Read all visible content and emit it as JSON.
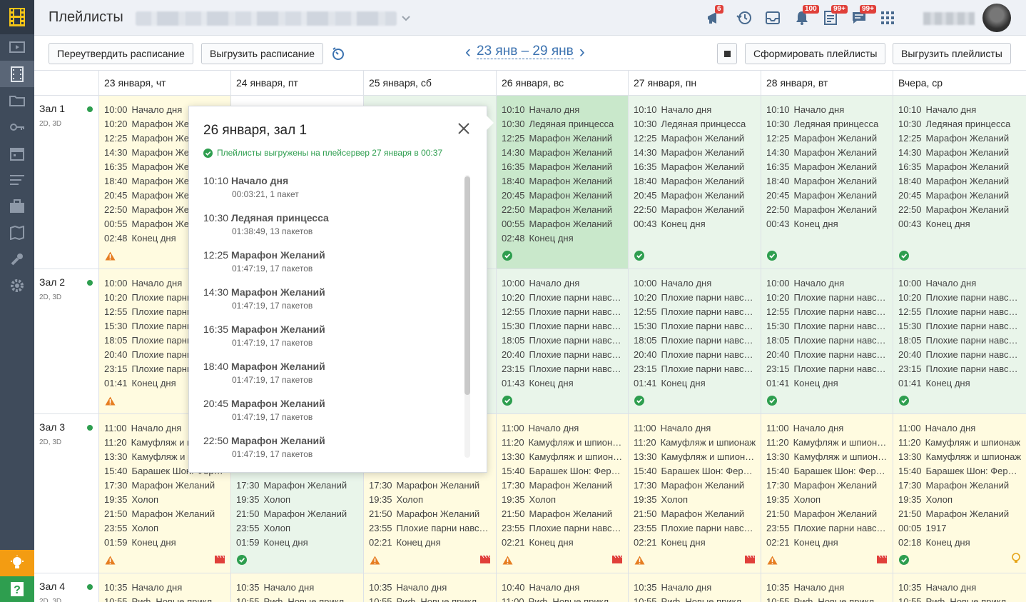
{
  "header": {
    "title": "Плейлисты",
    "badges": {
      "announcements": "6",
      "notifications": "100",
      "tasks": "99+",
      "messages": "99+"
    }
  },
  "toolbar": {
    "reapprove_label": "Переутвердить расписание",
    "export_schedule_label": "Выгрузить расписание",
    "week_label": "23 янв – 29 янв",
    "prev": "‹",
    "next": "›",
    "generate_label": "Сформировать плейлисты",
    "export_playlists_label": "Выгрузить плейлисты"
  },
  "days": [
    "23 января, чт",
    "24 января, пт",
    "25 января, сб",
    "26 января, вс",
    "27 января, пн",
    "28 января, вт",
    "Вчера, ср"
  ],
  "halls": [
    {
      "name": "Зал 1",
      "formats": "2D, 3D",
      "cells": [
        {
          "bg": "yellow",
          "status": "warning",
          "rows": [
            [
              "10:00",
              "Начало дня"
            ],
            [
              "10:20",
              "Марафон Желаний"
            ],
            [
              "12:25",
              "Марафон Желаний"
            ],
            [
              "14:30",
              "Марафон Желаний"
            ],
            [
              "16:35",
              "Марафон Желаний"
            ],
            [
              "18:40",
              "Марафон Желаний"
            ],
            [
              "20:45",
              "Марафон Желаний"
            ],
            [
              "22:50",
              "Марафон Желаний"
            ],
            [
              "00:55",
              "Марафон Желаний"
            ],
            [
              "02:48",
              "Конец дня"
            ]
          ]
        },
        {
          "bg": "none",
          "status": "none",
          "rows": []
        },
        {
          "bg": "green",
          "status": "none",
          "rows": []
        },
        {
          "bg": "green-strong",
          "status": "ok",
          "rows": [
            [
              "10:10",
              "Начало дня"
            ],
            [
              "10:30",
              "Ледяная принцесса"
            ],
            [
              "12:25",
              "Марафон Желаний"
            ],
            [
              "14:30",
              "Марафон Желаний"
            ],
            [
              "16:35",
              "Марафон Желаний"
            ],
            [
              "18:40",
              "Марафон Желаний"
            ],
            [
              "20:45",
              "Марафон Желаний"
            ],
            [
              "22:50",
              "Марафон Желаний"
            ],
            [
              "00:55",
              "Марафон Желаний"
            ],
            [
              "02:48",
              "Конец дня"
            ]
          ]
        },
        {
          "bg": "green",
          "status": "ok",
          "rows": [
            [
              "10:10",
              "Начало дня"
            ],
            [
              "10:30",
              "Ледяная принцесса"
            ],
            [
              "12:25",
              "Марафон Желаний"
            ],
            [
              "14:30",
              "Марафон Желаний"
            ],
            [
              "16:35",
              "Марафон Желаний"
            ],
            [
              "18:40",
              "Марафон Желаний"
            ],
            [
              "20:45",
              "Марафон Желаний"
            ],
            [
              "22:50",
              "Марафон Желаний"
            ],
            [
              "00:43",
              "Конец дня"
            ]
          ]
        },
        {
          "bg": "green",
          "status": "ok",
          "rows": [
            [
              "10:10",
              "Начало дня"
            ],
            [
              "10:30",
              "Ледяная принцесса"
            ],
            [
              "12:25",
              "Марафон Желаний"
            ],
            [
              "14:30",
              "Марафон Желаний"
            ],
            [
              "16:35",
              "Марафон Желаний"
            ],
            [
              "18:40",
              "Марафон Желаний"
            ],
            [
              "20:45",
              "Марафон Желаний"
            ],
            [
              "22:50",
              "Марафон Желаний"
            ],
            [
              "00:43",
              "Конец дня"
            ]
          ]
        },
        {
          "bg": "green",
          "status": "ok",
          "rows": [
            [
              "10:10",
              "Начало дня"
            ],
            [
              "10:30",
              "Ледяная принцесса"
            ],
            [
              "12:25",
              "Марафон Желаний"
            ],
            [
              "14:30",
              "Марафон Желаний"
            ],
            [
              "16:35",
              "Марафон Желаний"
            ],
            [
              "18:40",
              "Марафон Желаний"
            ],
            [
              "20:45",
              "Марафон Желаний"
            ],
            [
              "22:50",
              "Марафон Желаний"
            ],
            [
              "00:43",
              "Конец дня"
            ]
          ]
        }
      ]
    },
    {
      "name": "Зал 2",
      "formats": "2D, 3D",
      "cells": [
        {
          "bg": "yellow",
          "status": "warning",
          "rows": [
            [
              "10:00",
              "Начало дня"
            ],
            [
              "10:20",
              "Плохие парни навсегда"
            ],
            [
              "12:55",
              "Плохие парни навсегда"
            ],
            [
              "15:30",
              "Плохие парни навсегда"
            ],
            [
              "18:05",
              "Плохие парни навсегда"
            ],
            [
              "20:40",
              "Плохие парни навсегда"
            ],
            [
              "23:15",
              "Плохие парни навсегда"
            ],
            [
              "01:41",
              "Конец дня"
            ]
          ]
        },
        {
          "bg": "green",
          "status": "none",
          "rows": []
        },
        {
          "bg": "green",
          "status": "none",
          "rows": []
        },
        {
          "bg": "green",
          "status": "ok",
          "rows": [
            [
              "10:00",
              "Начало дня"
            ],
            [
              "10:20",
              "Плохие парни навсегда"
            ],
            [
              "12:55",
              "Плохие парни навсегда"
            ],
            [
              "15:30",
              "Плохие парни навсегда"
            ],
            [
              "18:05",
              "Плохие парни навсегда"
            ],
            [
              "20:40",
              "Плохие парни навсегда"
            ],
            [
              "23:15",
              "Плохие парни навсегда"
            ],
            [
              "01:43",
              "Конец дня"
            ]
          ]
        },
        {
          "bg": "green",
          "status": "ok",
          "rows": [
            [
              "10:00",
              "Начало дня"
            ],
            [
              "10:20",
              "Плохие парни навсегда"
            ],
            [
              "12:55",
              "Плохие парни навсегда"
            ],
            [
              "15:30",
              "Плохие парни навсегда"
            ],
            [
              "18:05",
              "Плохие парни навсегда"
            ],
            [
              "20:40",
              "Плохие парни навсегда"
            ],
            [
              "23:15",
              "Плохие парни навсегда"
            ],
            [
              "01:41",
              "Конец дня"
            ]
          ]
        },
        {
          "bg": "green",
          "status": "ok",
          "rows": [
            [
              "10:00",
              "Начало дня"
            ],
            [
              "10:20",
              "Плохие парни навсегда"
            ],
            [
              "12:55",
              "Плохие парни навсегда"
            ],
            [
              "15:30",
              "Плохие парни навсегда"
            ],
            [
              "18:05",
              "Плохие парни навсегда"
            ],
            [
              "20:40",
              "Плохие парни навсегда"
            ],
            [
              "23:15",
              "Плохие парни навсегда"
            ],
            [
              "01:41",
              "Конец дня"
            ]
          ]
        },
        {
          "bg": "green",
          "status": "ok",
          "rows": [
            [
              "10:00",
              "Начало дня"
            ],
            [
              "10:20",
              "Плохие парни навсегда"
            ],
            [
              "12:55",
              "Плохие парни навсегда"
            ],
            [
              "15:30",
              "Плохие парни навсегда"
            ],
            [
              "18:05",
              "Плохие парни навсегда"
            ],
            [
              "20:40",
              "Плохие парни навсегда"
            ],
            [
              "23:15",
              "Плохие парни навсегда"
            ],
            [
              "01:41",
              "Конец дня"
            ]
          ]
        }
      ]
    },
    {
      "name": "Зал 3",
      "formats": "2D, 3D",
      "cells": [
        {
          "bg": "yellow",
          "status": "warning",
          "flag": "film",
          "rows": [
            [
              "11:00",
              "Начало дня"
            ],
            [
              "11:20",
              "Камуфляж и шпионаж"
            ],
            [
              "13:30",
              "Камуфляж и шпионаж"
            ],
            [
              "15:40",
              "Барашек Шон: Фермагеддон"
            ],
            [
              "17:30",
              "Марафон Желаний"
            ],
            [
              "19:35",
              "Холоп"
            ],
            [
              "21:50",
              "Марафон Желаний"
            ],
            [
              "23:55",
              "Холоп"
            ],
            [
              "01:59",
              "Конец дня"
            ]
          ]
        },
        {
          "bg": "green",
          "status": "ok",
          "rows": [
            [
              "",
              "",
              ""
            ],
            [
              "",
              "",
              ""
            ],
            [
              "",
              "",
              ""
            ],
            [
              "",
              "",
              ""
            ],
            [
              "17:30",
              "Марафон Желаний"
            ],
            [
              "19:35",
              "Холоп"
            ],
            [
              "21:50",
              "Марафон Желаний"
            ],
            [
              "23:55",
              "Холоп"
            ],
            [
              "01:59",
              "Конец дня"
            ]
          ]
        },
        {
          "bg": "yellow",
          "status": "warning",
          "flag": "film",
          "rows": [
            [
              "",
              "",
              ""
            ],
            [
              "",
              "",
              ""
            ],
            [
              "",
              "",
              ""
            ],
            [
              "",
              "",
              ""
            ],
            [
              "17:30",
              "Марафон Желаний"
            ],
            [
              "19:35",
              "Холоп"
            ],
            [
              "21:50",
              "Марафон Желаний"
            ],
            [
              "23:55",
              "Плохие парни навсегда"
            ],
            [
              "02:21",
              "Конец дня"
            ]
          ]
        },
        {
          "bg": "yellow",
          "status": "warning",
          "flag": "film",
          "rows": [
            [
              "11:00",
              "Начало дня"
            ],
            [
              "11:20",
              "Камуфляж и шпионаж"
            ],
            [
              "13:30",
              "Камуфляж и шпионаж"
            ],
            [
              "15:40",
              "Барашек Шон: Фермагеддон"
            ],
            [
              "17:30",
              "Марафон Желаний"
            ],
            [
              "19:35",
              "Холоп"
            ],
            [
              "21:50",
              "Марафон Желаний"
            ],
            [
              "23:55",
              "Плохие парни навсегда"
            ],
            [
              "02:21",
              "Конец дня"
            ]
          ]
        },
        {
          "bg": "yellow",
          "status": "warning",
          "flag": "film",
          "rows": [
            [
              "11:00",
              "Начало дня"
            ],
            [
              "11:20",
              "Камуфляж и шпионаж"
            ],
            [
              "13:30",
              "Камуфляж и шпионаж"
            ],
            [
              "15:40",
              "Барашек Шон: Фермагеддон"
            ],
            [
              "17:30",
              "Марафон Желаний"
            ],
            [
              "19:35",
              "Холоп"
            ],
            [
              "21:50",
              "Марафон Желаний"
            ],
            [
              "23:55",
              "Плохие парни навсегда"
            ],
            [
              "02:21",
              "Конец дня"
            ]
          ]
        },
        {
          "bg": "yellow",
          "status": "warning",
          "flag": "film",
          "rows": [
            [
              "11:00",
              "Начало дня"
            ],
            [
              "11:20",
              "Камуфляж и шпионаж"
            ],
            [
              "13:30",
              "Камуфляж и шпионаж"
            ],
            [
              "15:40",
              "Барашек Шон: Фермагеддон"
            ],
            [
              "17:30",
              "Марафон Желаний"
            ],
            [
              "19:35",
              "Холоп"
            ],
            [
              "21:50",
              "Марафон Желаний"
            ],
            [
              "23:55",
              "Плохие парни навсегда"
            ],
            [
              "02:21",
              "Конец дня"
            ]
          ]
        },
        {
          "bg": "yellow",
          "status": "ok",
          "flag": "bulb",
          "rows": [
            [
              "11:00",
              "Начало дня"
            ],
            [
              "11:20",
              "Камуфляж и шпионаж"
            ],
            [
              "13:30",
              "Камуфляж и шпионаж"
            ],
            [
              "15:40",
              "Барашек Шон: Фермагеддон"
            ],
            [
              "17:30",
              "Марафон Желаний"
            ],
            [
              "19:35",
              "Холоп"
            ],
            [
              "21:50",
              "Марафон Желаний"
            ],
            [
              "00:05",
              "1917"
            ],
            [
              "02:18",
              "Конец дня"
            ]
          ]
        }
      ]
    },
    {
      "name": "Зал 4",
      "formats": "2D, 3D",
      "cells": [
        {
          "bg": "yellow",
          "status": "none",
          "rows": [
            [
              "10:35",
              "Начало дня"
            ],
            [
              "10:55",
              "Риф. Новые приключения"
            ]
          ]
        },
        {
          "bg": "yellow",
          "status": "none",
          "rows": [
            [
              "10:35",
              "Начало дня"
            ],
            [
              "10:55",
              "Риф. Новые приключения"
            ]
          ]
        },
        {
          "bg": "yellow",
          "status": "none",
          "rows": [
            [
              "10:35",
              "Начало дня"
            ],
            [
              "10:55",
              "Риф. Новые приключения"
            ]
          ]
        },
        {
          "bg": "yellow",
          "status": "none",
          "rows": [
            [
              "10:40",
              "Начало дня"
            ],
            [
              "11:00",
              "Риф. Новые приключения"
            ]
          ]
        },
        {
          "bg": "yellow",
          "status": "none",
          "rows": [
            [
              "10:35",
              "Начало дня"
            ],
            [
              "10:55",
              "Риф. Новые приключения"
            ]
          ]
        },
        {
          "bg": "yellow",
          "status": "none",
          "rows": [
            [
              "10:35",
              "Начало дня"
            ],
            [
              "10:55",
              "Риф. Новые приключения"
            ]
          ]
        },
        {
          "bg": "yellow",
          "status": "none",
          "rows": [
            [
              "10:35",
              "Начало дня"
            ],
            [
              "10:55",
              "Риф. Новые приключения"
            ]
          ]
        }
      ]
    }
  ],
  "popup": {
    "title": "26 января, зал 1",
    "status": "Плейлисты выгружены на плейсервер 27 января в 00:37",
    "items": [
      {
        "time": "10:10",
        "title": "Начало дня",
        "sub": "00:03:21, 1 пакет"
      },
      {
        "time": "10:30",
        "title": "Ледяная принцесса",
        "sub": "01:38:49, 13 пакетов"
      },
      {
        "time": "12:25",
        "title": "Марафон Желаний",
        "sub": "01:47:19, 17 пакетов"
      },
      {
        "time": "14:30",
        "title": "Марафон Желаний",
        "sub": "01:47:19, 17 пакетов"
      },
      {
        "time": "16:35",
        "title": "Марафон Желаний",
        "sub": "01:47:19, 17 пакетов"
      },
      {
        "time": "18:40",
        "title": "Марафон Желаний",
        "sub": "01:47:19, 17 пакетов"
      },
      {
        "time": "20:45",
        "title": "Марафон Желаний",
        "sub": "01:47:19, 17 пакетов"
      },
      {
        "time": "22:50",
        "title": "Марафон Желаний",
        "sub": "01:47:19, 17 пакетов"
      }
    ]
  },
  "colors": {
    "accent": "#3b72b0",
    "ok": "#2e9e4f",
    "warning": "#e67e22",
    "sidebar": "#3f4b5b"
  }
}
